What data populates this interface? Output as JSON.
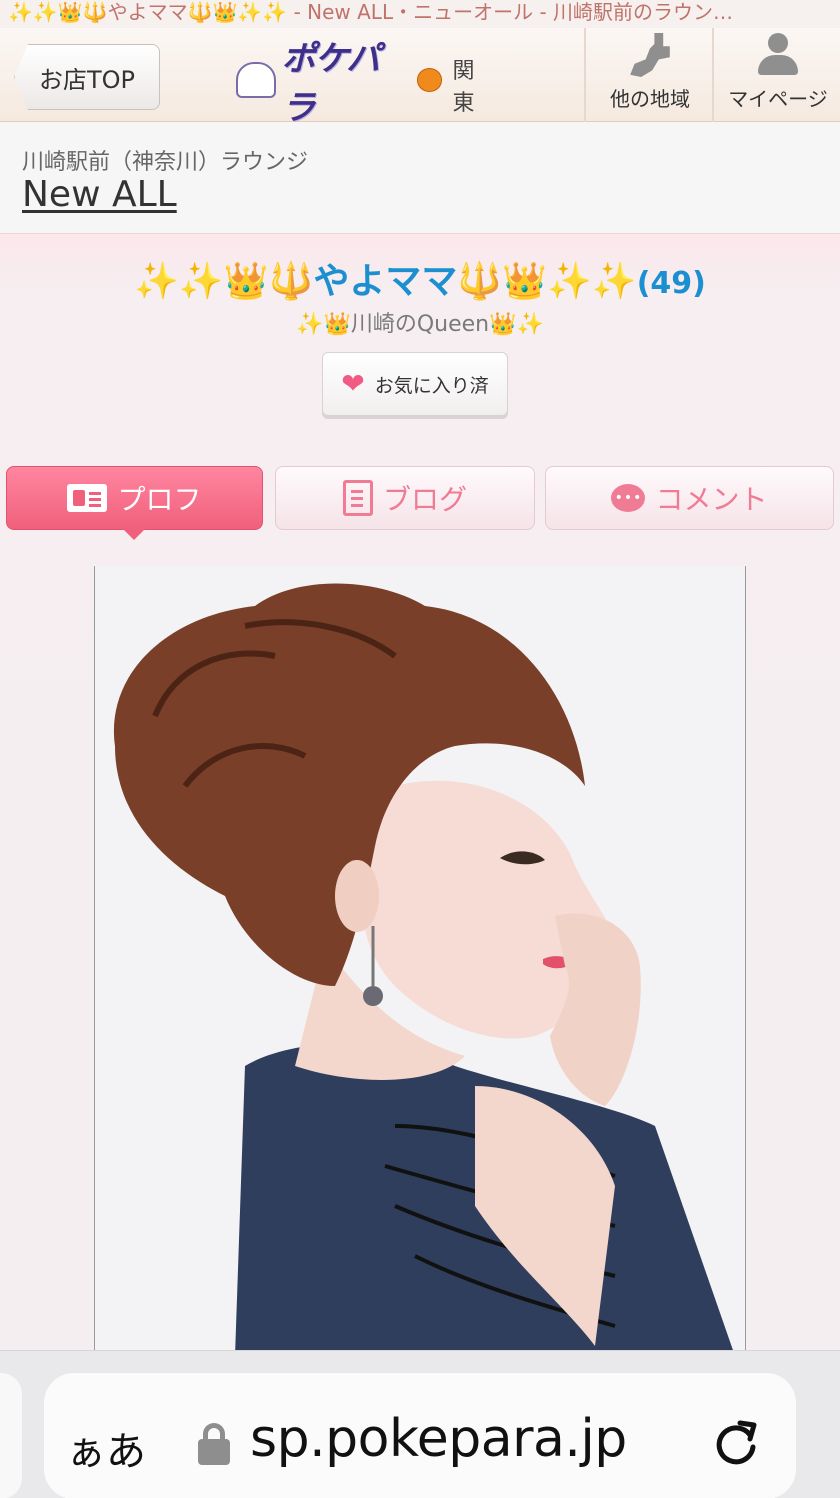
{
  "page_title": "✨✨👑🔱やよママ🔱👑✨✨ - New ALL・ニューオール - 川崎駅前のラウン…",
  "header": {
    "back_label": "お店TOP",
    "logo_text": "ポケパラ",
    "region": "関東",
    "other_region_label": "他の地域",
    "mypage_label": "マイページ",
    "icons": [
      "japan-map-icon",
      "person-icon"
    ]
  },
  "shop": {
    "category": "川崎駅前（神奈川）ラウンジ",
    "name": "New ALL"
  },
  "cast": {
    "name": "✨✨👑🔱やよママ🔱👑✨✨",
    "count": "(49)",
    "catchphrase": "✨👑川崎のQueen👑✨",
    "favorite_label": "お気に入り済"
  },
  "tabs": [
    {
      "label": "プロフ",
      "icon": "profile-card-icon",
      "active": true
    },
    {
      "label": "ブログ",
      "icon": "blog-icon",
      "active": false
    },
    {
      "label": "コメント",
      "icon": "comment-icon",
      "active": false
    }
  ],
  "photo": {
    "alt": "profile photo"
  },
  "browser": {
    "aa_label": "ぁあ",
    "url": "sp.pokepara.jp"
  },
  "colors": {
    "accent_pink": "#f0607c",
    "name_blue": "#1c8fd1",
    "title_text": "#c0736a"
  }
}
